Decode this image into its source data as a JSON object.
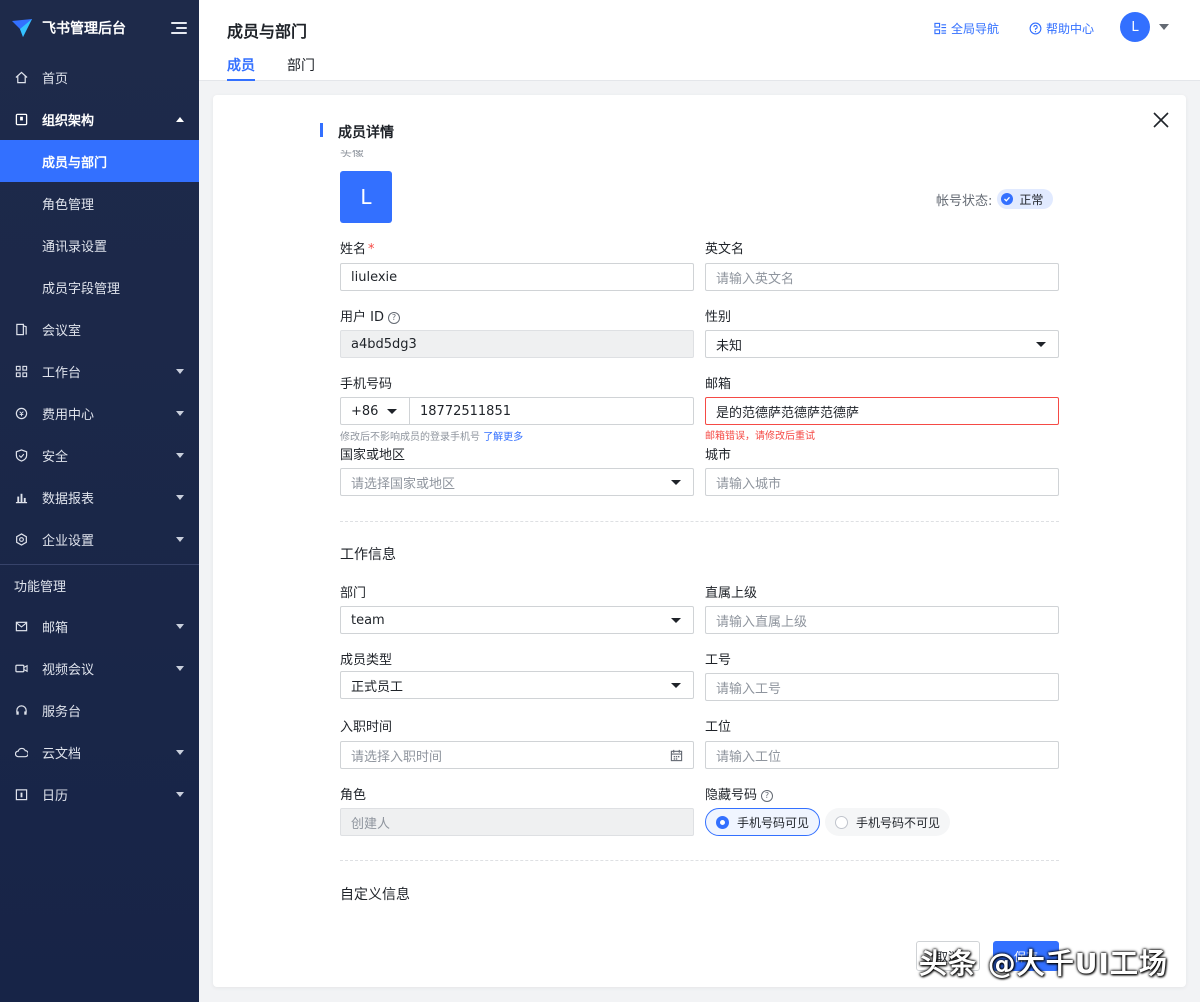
{
  "sidebar": {
    "brand": "飞书管理后台",
    "items": [
      {
        "label": "首页",
        "icon": "home-icon"
      },
      {
        "label": "组织架构",
        "icon": "org-icon",
        "open": true,
        "children": [
          {
            "label": "成员与部门",
            "active": true
          },
          {
            "label": "角色管理"
          },
          {
            "label": "通讯录设置"
          },
          {
            "label": "成员字段管理"
          }
        ]
      },
      {
        "label": "会议室",
        "icon": "meeting-room-icon"
      },
      {
        "label": "工作台",
        "icon": "workbench-icon",
        "caret": true
      },
      {
        "label": "费用中心",
        "icon": "billing-icon",
        "caret": true
      },
      {
        "label": "安全",
        "icon": "shield-icon",
        "caret": true
      },
      {
        "label": "数据报表",
        "icon": "chart-icon",
        "caret": true
      },
      {
        "label": "企业设置",
        "icon": "settings-icon",
        "caret": true
      }
    ],
    "group_title": "功能管理",
    "feature_items": [
      {
        "label": "邮箱",
        "icon": "mail-icon",
        "caret": true
      },
      {
        "label": "视频会议",
        "icon": "video-icon",
        "caret": true
      },
      {
        "label": "服务台",
        "icon": "headset-icon",
        "caret": false
      },
      {
        "label": "云文档",
        "icon": "cloud-doc-icon",
        "caret": true
      },
      {
        "label": "日历",
        "icon": "calendar-icon",
        "caret": true
      }
    ]
  },
  "header": {
    "title": "成员与部门",
    "tabs": [
      "成员",
      "部门"
    ],
    "global_nav": "全局导航",
    "help_center": "帮助中心",
    "user_initial": "L"
  },
  "panel": {
    "title": "成员详情",
    "avatar_label": "头像",
    "avatar_initial": "L",
    "account_status_label": "帐号状态:",
    "account_status": "正常",
    "name_label": "姓名",
    "name_value": "liulexie",
    "english_name_label": "英文名",
    "english_name_placeholder": "请输入英文名",
    "user_id_label": "用户 ID",
    "user_id_value": "a4bd5dg3",
    "gender_label": "性别",
    "gender_value": "未知",
    "phone_label": "手机号码",
    "phone_code": "+86",
    "phone_value": "18772511851",
    "phone_hint": "修改后不影响成员的登录手机号",
    "learn_more": "了解更多",
    "email_label": "邮箱",
    "email_value": "是的范德萨范德萨范德萨",
    "email_error": "邮箱错误，请修改后重试",
    "country_label": "国家或地区",
    "country_placeholder": "请选择国家或地区",
    "city_label": "城市",
    "city_placeholder": "请输入城市",
    "work_section": "工作信息",
    "dept_label": "部门",
    "dept_value": "team",
    "manager_label": "直属上级",
    "manager_placeholder": "请输入直属上级",
    "member_type_label": "成员类型",
    "member_type_value": "正式员工",
    "employee_no_label": "工号",
    "employee_no_placeholder": "请输入工号",
    "join_date_label": "入职时间",
    "join_date_placeholder": "请选择入职时间",
    "workstation_label": "工位",
    "workstation_placeholder": "请输入工位",
    "role_label": "角色",
    "role_value": "创建人",
    "hide_phone_label": "隐藏号码",
    "phone_visible": "手机号码可见",
    "phone_invisible": "手机号码不可见",
    "custom_section": "自定义信息",
    "cancel": "取消",
    "save": "保存"
  },
  "watermark": "头条 @大千UI工场",
  "colors": {
    "accent": "#3370ff",
    "sidebar": "#1e2a4a",
    "error": "#f54a45"
  }
}
